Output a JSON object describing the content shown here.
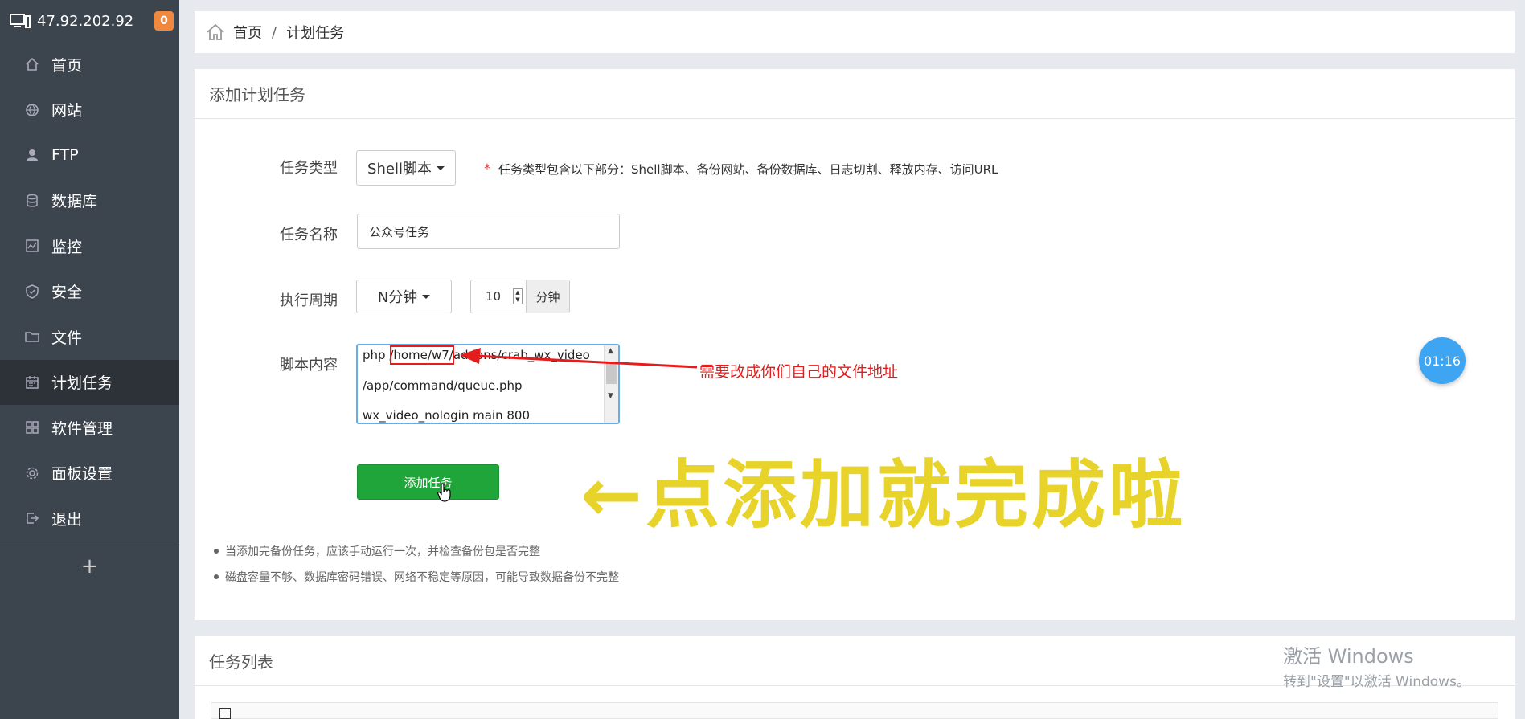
{
  "sidebar": {
    "server_ip": "47.92.202.92",
    "notification_count": "0",
    "items": [
      {
        "label": "首页",
        "icon": "home-icon"
      },
      {
        "label": "网站",
        "icon": "globe-icon"
      },
      {
        "label": "FTP",
        "icon": "user-icon"
      },
      {
        "label": "数据库",
        "icon": "database-icon"
      },
      {
        "label": "监控",
        "icon": "monitor-icon"
      },
      {
        "label": "安全",
        "icon": "shield-icon"
      },
      {
        "label": "文件",
        "icon": "folder-icon"
      },
      {
        "label": "计划任务",
        "icon": "calendar-icon",
        "active": true
      },
      {
        "label": "软件管理",
        "icon": "grid-icon"
      },
      {
        "label": "面板设置",
        "icon": "gear-icon"
      },
      {
        "label": "退出",
        "icon": "logout-icon"
      }
    ],
    "add_label": "+"
  },
  "breadcrumb": {
    "home": "首页",
    "separator": "/",
    "current": "计划任务"
  },
  "form": {
    "title": "添加计划任务",
    "task_type_label": "任务类型",
    "task_type_value": "Shell脚本",
    "required_mark": "*",
    "task_type_hint": "任务类型包含以下部分：Shell脚本、备份网站、备份数据库、日志切割、释放内存、访问URL",
    "task_name_label": "任务名称",
    "task_name_value": "公众号任务",
    "cycle_label": "执行周期",
    "cycle_value": "N分钟",
    "cycle_number": "10",
    "cycle_unit": "分钟",
    "script_label": "脚本内容",
    "script_lines": [
      "php /home/w7/addons/crab_wx_video",
      "/app/command/queue.php",
      "wx_video_nologin main 800"
    ],
    "submit_label": "添加任务",
    "notes": [
      "当添加完备份任务，应该手动运行一次，并检查备份包是否完整",
      "磁盘容量不够、数据库密码错误、网络不稳定等原因，可能导致数据备份不完整"
    ]
  },
  "annotations": {
    "path_hint": "需要改成你们自己的文件地址",
    "click_hint": "←点添加就完成啦",
    "red_color": "#e41c1c",
    "yellow_color": "#e8d32b"
  },
  "timer": "01:16",
  "task_list": {
    "title": "任务列表"
  },
  "watermark": {
    "line1": "激活 Windows",
    "line2": "转到\"设置\"以激活 Windows。"
  },
  "colors": {
    "sidebar_bg": "#3c444d",
    "accent_green": "#20a53a",
    "timer_blue": "#3ea5f3"
  }
}
